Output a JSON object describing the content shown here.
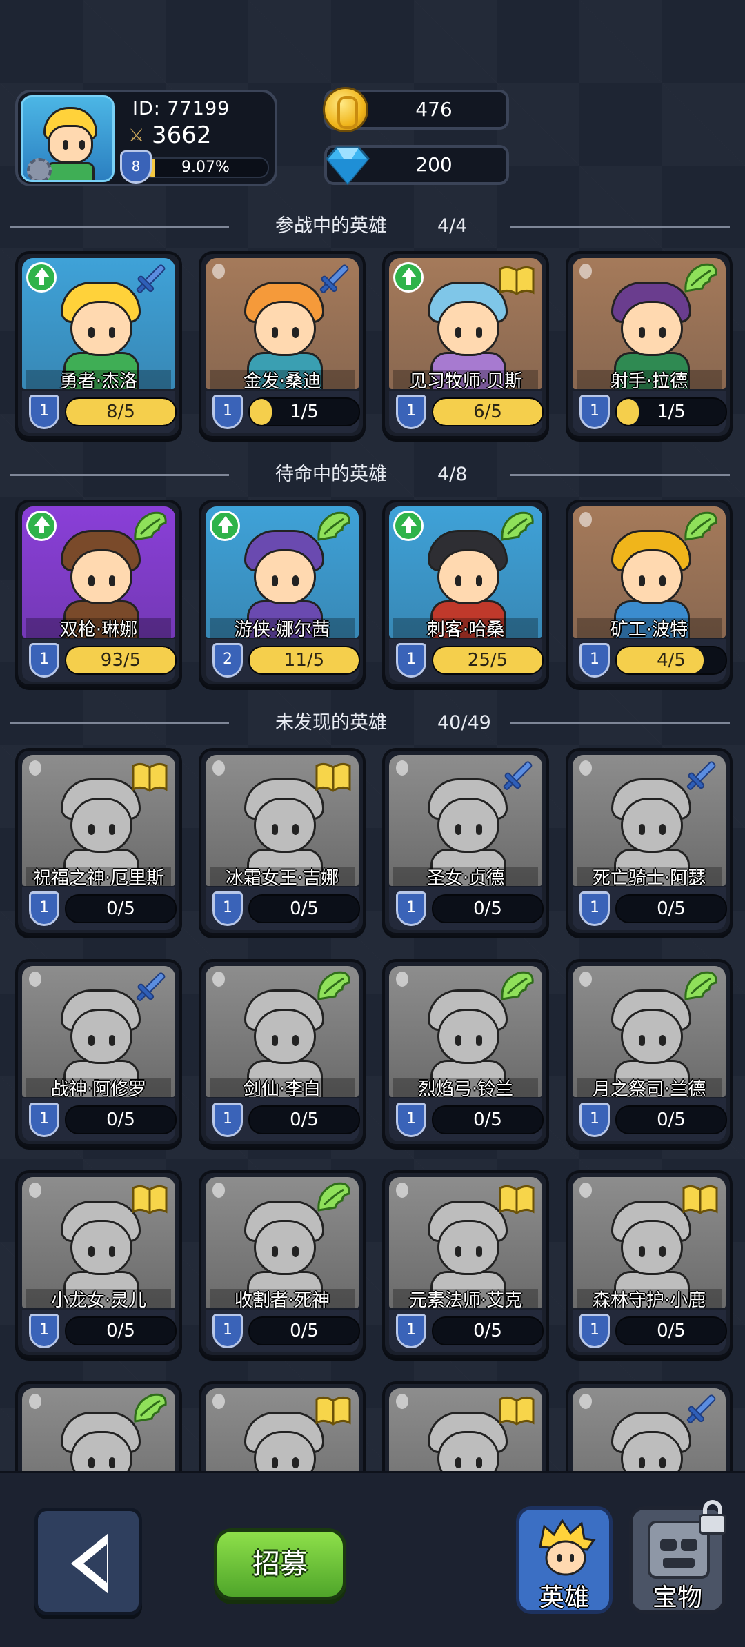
{
  "player": {
    "id_label": "ID:  77199",
    "power": "3662",
    "level": "8",
    "exp_percent": "9.07%",
    "exp_fraction": 0.0907
  },
  "currency": {
    "gold": "476",
    "gems": "200"
  },
  "sections": {
    "deployed": {
      "title": "参战中的英雄",
      "count": "4/4"
    },
    "standby": {
      "title": "待命中的英雄",
      "count": "4/8"
    },
    "undiscovered": {
      "title": "未发现的英雄",
      "count": "40/49"
    }
  },
  "deployed_heroes": [
    {
      "name": "勇者·杰洛",
      "level": "1",
      "shards": "8/5",
      "fill": 1.0,
      "class_icon": "sword-icon",
      "upgrade": true,
      "bg": "#3fa2d8",
      "hair": "#ffd23a",
      "skin": "#ffd9b0",
      "outfit": "#3fae55"
    },
    {
      "name": "金发·桑迪",
      "level": "1",
      "shards": "1/5",
      "fill": 0.2,
      "class_icon": "sword-icon",
      "upgrade": false,
      "bg": "#a57a5a",
      "hair": "#f59a3a",
      "skin": "#ffd9b0",
      "outfit": "#3a9fb2"
    },
    {
      "name": "见习牧师·贝斯",
      "level": "1",
      "shards": "6/5",
      "fill": 1.0,
      "class_icon": "book-icon",
      "upgrade": true,
      "bg": "#a57a5a",
      "hair": "#7fc6e8",
      "skin": "#ffd9b0",
      "outfit": "#a77ad0"
    },
    {
      "name": "射手·拉德",
      "level": "1",
      "shards": "1/5",
      "fill": 0.2,
      "class_icon": "wing-icon",
      "upgrade": false,
      "bg": "#a57a5a",
      "hair": "#6a3d8e",
      "skin": "#ffd9b0",
      "outfit": "#2f8a52"
    }
  ],
  "standby_heroes": [
    {
      "name": "双枪·琳娜",
      "level": "1",
      "shards": "93/5",
      "fill": 1.0,
      "class_icon": "wing-icon",
      "upgrade": true,
      "bg": "#8a3fd8",
      "hair": "#7a4a2a",
      "skin": "#ffd9b0",
      "outfit": "#7a4a2a"
    },
    {
      "name": "游侠·娜尔茜",
      "level": "2",
      "shards": "11/5",
      "fill": 1.0,
      "class_icon": "wing-icon",
      "upgrade": true,
      "bg": "#3fa2d8",
      "hair": "#6a4ab0",
      "skin": "#ffd9b0",
      "outfit": "#6a4ab0"
    },
    {
      "name": "刺客·哈桑",
      "level": "1",
      "shards": "25/5",
      "fill": 1.0,
      "class_icon": "wing-icon",
      "upgrade": true,
      "bg": "#3fa2d8",
      "hair": "#2e2e33",
      "skin": "#ffd9b0",
      "outfit": "#c0392b"
    },
    {
      "name": "矿工·波特",
      "level": "1",
      "shards": "4/5",
      "fill": 0.8,
      "class_icon": "wing-icon",
      "upgrade": false,
      "bg": "#a57a5a",
      "hair": "#f0b51b",
      "skin": "#ffd9b0",
      "outfit": "#3b8ccf"
    }
  ],
  "undiscovered_heroes": [
    {
      "name": "祝福之神·厄里斯",
      "level": "1",
      "shards": "0/5",
      "fill": 0,
      "class_icon": "book-icon"
    },
    {
      "name": "冰霜女王·吉娜",
      "level": "1",
      "shards": "0/5",
      "fill": 0,
      "class_icon": "book-icon"
    },
    {
      "name": "圣女·贞德",
      "level": "1",
      "shards": "0/5",
      "fill": 0,
      "class_icon": "sword-icon"
    },
    {
      "name": "死亡骑士·阿瑟",
      "level": "1",
      "shards": "0/5",
      "fill": 0,
      "class_icon": "sword-icon"
    },
    {
      "name": "战神·阿修罗",
      "level": "1",
      "shards": "0/5",
      "fill": 0,
      "class_icon": "sword-icon"
    },
    {
      "name": "剑仙·李白",
      "level": "1",
      "shards": "0/5",
      "fill": 0,
      "class_icon": "wing-icon"
    },
    {
      "name": "烈焰弓·铃兰",
      "level": "1",
      "shards": "0/5",
      "fill": 0,
      "class_icon": "wing-icon"
    },
    {
      "name": "月之祭司·兰德",
      "level": "1",
      "shards": "0/5",
      "fill": 0,
      "class_icon": "wing-icon"
    },
    {
      "name": "小龙女·灵儿",
      "level": "1",
      "shards": "0/5",
      "fill": 0,
      "class_icon": "book-icon"
    },
    {
      "name": "收割者·死神",
      "level": "1",
      "shards": "0/5",
      "fill": 0,
      "class_icon": "wing-icon"
    },
    {
      "name": "元素法师·艾克",
      "level": "1",
      "shards": "0/5",
      "fill": 0,
      "class_icon": "book-icon"
    },
    {
      "name": "森林守护·小鹿",
      "level": "1",
      "shards": "0/5",
      "fill": 0,
      "class_icon": "book-icon"
    },
    {
      "name": "",
      "level": "",
      "shards": "",
      "fill": 0,
      "class_icon": "wing-icon"
    },
    {
      "name": "",
      "level": "",
      "shards": "",
      "fill": 0,
      "class_icon": "book-icon"
    },
    {
      "name": "",
      "level": "",
      "shards": "",
      "fill": 0,
      "class_icon": "book-icon"
    },
    {
      "name": "",
      "level": "",
      "shards": "",
      "fill": 0,
      "class_icon": "sword-icon"
    }
  ],
  "bottom_bar": {
    "recruit_label": "招募",
    "heroes_tab_label": "英雄",
    "treasure_tab_label": "宝物"
  }
}
